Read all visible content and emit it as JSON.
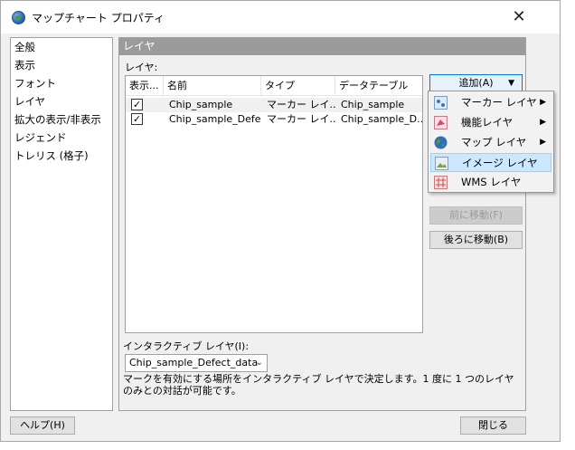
{
  "window": {
    "title": "マップチャート プロパティ"
  },
  "nav": {
    "items": [
      {
        "label": "全般"
      },
      {
        "label": "表示"
      },
      {
        "label": "フォント"
      },
      {
        "label": "レイヤ"
      },
      {
        "label": "拡大の表示/非表示"
      },
      {
        "label": "レジェンド"
      },
      {
        "label": "トレリス (格子)"
      }
    ]
  },
  "section": {
    "header": "レイヤ",
    "layers_label": "レイヤ:"
  },
  "table": {
    "headers": [
      "表示...",
      "名前",
      "タイプ",
      "データテーブル"
    ],
    "rows": [
      {
        "checked": "✓",
        "name": "Chip_sample",
        "type": "マーカー レイ...",
        "table": "Chip_sample"
      },
      {
        "checked": "✓",
        "name": "Chip_sample_Defe...",
        "type": "マーカー レイ...",
        "table": "Chip_sample_D..."
      }
    ]
  },
  "buttons": {
    "add": "追加(A)",
    "move_up": "前に移動(F)",
    "move_down": "後ろに移動(B)",
    "help": "ヘルプ(H)",
    "close": "閉じる"
  },
  "add_menu": {
    "items": [
      {
        "label": "マーカー レイヤ",
        "arrow": "▶"
      },
      {
        "label": "機能レイヤ",
        "arrow": "▶"
      },
      {
        "label": "マップ レイヤ",
        "arrow": "▶"
      },
      {
        "label": "イメージ レイヤ",
        "arrow": ""
      },
      {
        "label": "WMS レイヤ",
        "arrow": ""
      }
    ]
  },
  "interactive": {
    "label": "インタラクティブ レイヤ(I):",
    "value": "Chip_sample_Defect_data",
    "description": "マークを有効にする場所をインタラクティブ レイヤで決定します。1 度に 1 つのレイヤのみとの対話が可能です。"
  }
}
